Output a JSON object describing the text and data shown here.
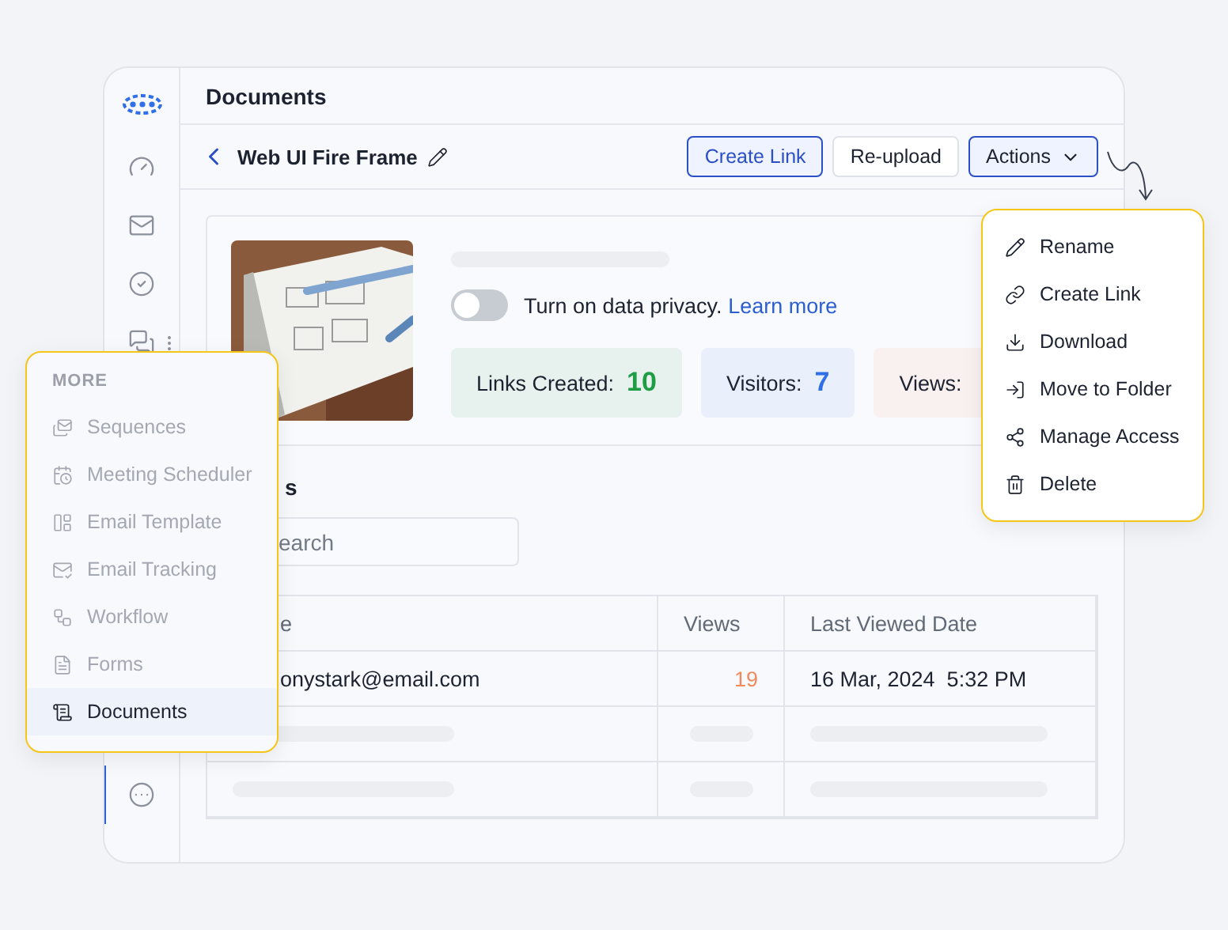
{
  "header": {
    "title": "Documents"
  },
  "sidebar": {
    "items": [
      {
        "kind": "gauge",
        "selected": false
      },
      {
        "kind": "mail",
        "selected": false
      },
      {
        "kind": "check",
        "selected": false
      },
      {
        "kind": "chat",
        "selected": false
      },
      {
        "kind": "more",
        "selected": true
      }
    ]
  },
  "toolbar": {
    "title": "Web UI Fire Frame",
    "buttons": [
      {
        "label": "Create Link",
        "kind": "primary"
      },
      {
        "label": "Re-upload",
        "kind": "plain"
      },
      {
        "label": "Actions",
        "kind": "menu"
      }
    ]
  },
  "document": {
    "privacy_on": false,
    "privacy_text": "Turn on data privacy.",
    "learn_more": "Learn more",
    "stats": [
      {
        "label": "Links Created:",
        "value": "10",
        "kind": "links"
      },
      {
        "label": "Visitors:",
        "value": "7",
        "kind": "visitors"
      },
      {
        "label": "Views:",
        "kind": "views"
      }
    ]
  },
  "visitors": {
    "heading": "s",
    "search": {
      "placeholder": "earch"
    },
    "table": {
      "columns": [
        "e",
        "Views",
        "Last Viewed Date"
      ],
      "rows": [
        {
          "kind": "data",
          "cells": [
            "onystark@email.com",
            "19",
            "16 Mar, 2024  5:32 PM"
          ]
        },
        {
          "kind": "placeholder"
        },
        {
          "kind": "placeholder"
        }
      ]
    }
  },
  "actions_menu": {
    "items": [
      {
        "kind": "pencil",
        "label": "Rename"
      },
      {
        "kind": "link",
        "label": "Create Link"
      },
      {
        "kind": "download",
        "label": "Download"
      },
      {
        "kind": "move",
        "label": "Move to Folder"
      },
      {
        "kind": "share",
        "label": "Manage Access"
      },
      {
        "kind": "trash",
        "label": "Delete"
      }
    ]
  },
  "more_menu": {
    "title": "MORE",
    "items": [
      {
        "kind": "sequences",
        "label": "Sequences",
        "selected": false
      },
      {
        "kind": "calendar",
        "label": "Meeting Scheduler",
        "selected": false
      },
      {
        "kind": "template",
        "label": "Email Template",
        "selected": false
      },
      {
        "kind": "tracking",
        "label": "Email Tracking",
        "selected": false
      },
      {
        "kind": "workflow",
        "label": "Workflow",
        "selected": false
      },
      {
        "kind": "forms",
        "label": "Forms",
        "selected": false
      },
      {
        "kind": "documents",
        "label": "Documents",
        "selected": true
      }
    ]
  }
}
